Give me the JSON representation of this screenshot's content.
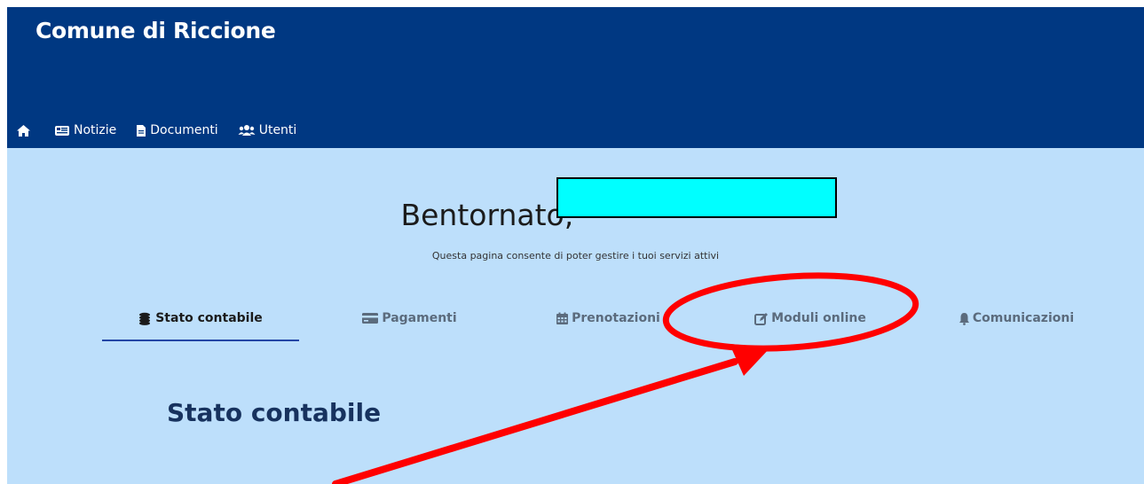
{
  "header": {
    "brand": "Comune di Riccione",
    "nav": [
      {
        "icon": "home-icon",
        "label": ""
      },
      {
        "icon": "newspaper-icon",
        "label": "Notizie"
      },
      {
        "icon": "document-icon",
        "label": "Documenti"
      },
      {
        "icon": "users-icon",
        "label": "Utenti"
      }
    ]
  },
  "welcome": {
    "greeting": "Bentornato,",
    "subtitle": "Questa pagina consente di poter gestire i tuoi servizi attivi"
  },
  "tabs": [
    {
      "icon": "coins-icon",
      "label": "Stato contabile",
      "active": true
    },
    {
      "icon": "credit-card-icon",
      "label": "Pagamenti",
      "active": false
    },
    {
      "icon": "calendar-icon",
      "label": "Prenotazioni",
      "active": false
    },
    {
      "icon": "edit-icon",
      "label": "Moduli online",
      "active": false
    },
    {
      "icon": "bell-icon",
      "label": "Comunicazioni",
      "active": false
    }
  ],
  "section": {
    "title": "Stato contabile"
  },
  "colors": {
    "header_bg": "#003882",
    "content_bg": "#bddffb",
    "active_underline": "#2446a6",
    "annotation_red": "#ff0000",
    "redaction_fill": "#00ffff"
  }
}
